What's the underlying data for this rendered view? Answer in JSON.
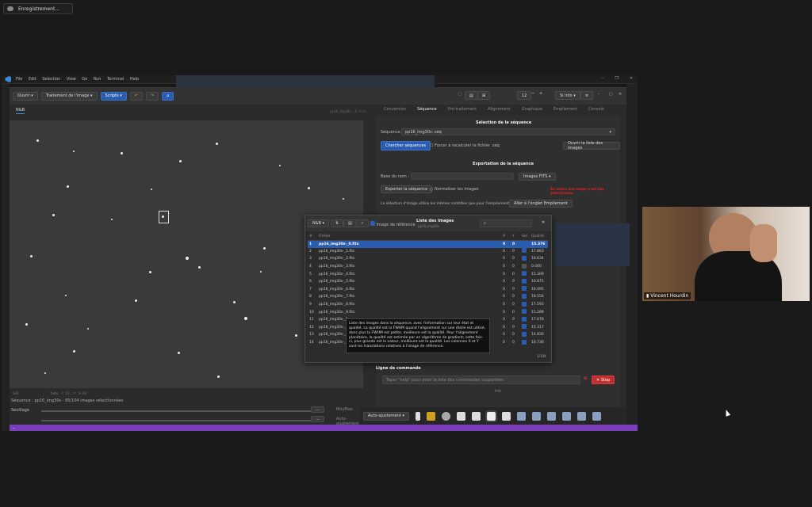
{
  "recording": {
    "label": "Enregistrement..."
  },
  "vscode": {
    "menu": [
      "File",
      "Edit",
      "Selection",
      "View",
      "Go",
      "Run",
      "Terminal",
      "Help"
    ]
  },
  "toolbar": {
    "open": "Ouvrir",
    "processing": "Traitement de l'image",
    "scripts": "Scripts",
    "zoom": "12",
    "info": "Si Info"
  },
  "image_tab": {
    "label": "N&B",
    "filename": "pp16_img30s-_0.fits"
  },
  "status": {
    "left": "S06",
    "fwhm": "fwhm: 7.13, r: 0.64",
    "bottom": "Séquence : pp16_img30s - 85/104 images sélectionnées"
  },
  "sliders": {
    "label1": "Seuillage",
    "label2": "",
    "opt1": "Min/Max",
    "opt2": "Auto-ajustement"
  },
  "right_tabs": [
    "Conversion",
    "Séquence",
    "Pré-traitement",
    "Alignement",
    "Graphique",
    "Empilement",
    "Console"
  ],
  "sequence": {
    "section_title": "Sélection de la séquence",
    "seq_label": "Séquence :",
    "seq_value": "pp16_img30s-.seq",
    "search_btn": "Chercher séquences",
    "recalc_label": "Forcer à recalculer le fichier .seq",
    "open_list_btn": "Ouvrir la liste des images"
  },
  "export": {
    "title": "Exportation de la séquence",
    "base_name_label": "Base du nom :",
    "format": "Images FITS",
    "export_btn": "Exporter la séquence",
    "normalize_label": "Normaliser les images",
    "warning": "Au moins une image n'est pas sélectionnée",
    "note": "La sélection d'image utilise les mêmes contrôles que pour l'empilement :",
    "goto_btn": "Aller à l'onglet Empilement"
  },
  "dialog": {
    "mode": "N&B",
    "ref_label": "Image de référence",
    "title": "Liste des images",
    "subtitle": "pp16_img30s",
    "columns": [
      "#",
      "Fichier",
      "X",
      "Y",
      "Sel",
      "Qualité"
    ],
    "rows": [
      {
        "n": "1",
        "file": "pp16_img30s-_0.fits",
        "x": "0",
        "y": "0",
        "sel": true,
        "q": "15.376"
      },
      {
        "n": "2",
        "file": "pp16_img30s-_1.fits",
        "x": "0",
        "y": "0",
        "sel": true,
        "q": "17.863"
      },
      {
        "n": "3",
        "file": "pp16_img30s-_2.fits",
        "x": "0",
        "y": "0",
        "sel": true,
        "q": "16.634"
      },
      {
        "n": "4",
        "file": "pp16_img30s-_3.fits",
        "x": "0",
        "y": "0",
        "sel": false,
        "q": "0.000"
      },
      {
        "n": "5",
        "file": "pp16_img30s-_4.fits",
        "x": "0",
        "y": "0",
        "sel": true,
        "q": "15.309"
      },
      {
        "n": "6",
        "file": "pp16_img30s-_5.fits",
        "x": "0",
        "y": "0",
        "sel": true,
        "q": "16.875"
      },
      {
        "n": "7",
        "file": "pp16_img30s-_6.fits",
        "x": "0",
        "y": "0",
        "sel": true,
        "q": "16.095"
      },
      {
        "n": "8",
        "file": "pp16_img30s-_7.fits",
        "x": "0",
        "y": "0",
        "sel": true,
        "q": "18.556"
      },
      {
        "n": "9",
        "file": "pp16_img30s-_8.fits",
        "x": "0",
        "y": "0",
        "sel": true,
        "q": "17.593"
      },
      {
        "n": "10",
        "file": "pp16_img30s-_9.fits",
        "x": "0",
        "y": "0",
        "sel": true,
        "q": "15.288"
      },
      {
        "n": "11",
        "file": "pp16_img30s-_1",
        "x": "0",
        "y": "0",
        "sel": true,
        "q": "17.678"
      },
      {
        "n": "12",
        "file": "pp16_img30s-_1",
        "x": "0",
        "y": "0",
        "sel": true,
        "q": "15.317"
      },
      {
        "n": "13",
        "file": "pp16_img30s-_1",
        "x": "0",
        "y": "0",
        "sel": true,
        "q": "14.830"
      },
      {
        "n": "14",
        "file": "pp16_img30s-_1",
        "x": "0",
        "y": "0",
        "sel": true,
        "q": "16.736"
      }
    ],
    "counter": "1/104"
  },
  "tooltip": {
    "text": "Liste des images dans la séquence, avec l'information sur leur état et qualité. La qualité est la FWHM quand l'alignement sur une étoile est utilisé, donc plus la FWHM est petite, meilleure est la qualité. Pour l'alignement planétaire, la qualité est estimée par un algorithme de gradient; cette fois-ci, plus grande est la valeur, meilleure est la qualité. Les colonnes X et Y sont les translations relatives à l'image de référence."
  },
  "command": {
    "title": "Ligne de commande",
    "placeholder": "Taper \"help\" pour avoir la liste des commandes supportées",
    "stop": "Stop",
    "pid": "Prêt"
  },
  "dock": {
    "select": "Auto-ajustement"
  },
  "camera": {
    "name": "Vincent Hourdin"
  },
  "colors": {
    "accent": "#2a5db0",
    "bottombar": "#7a3fb8",
    "stop": "#c03030",
    "warning": "#e02020"
  }
}
